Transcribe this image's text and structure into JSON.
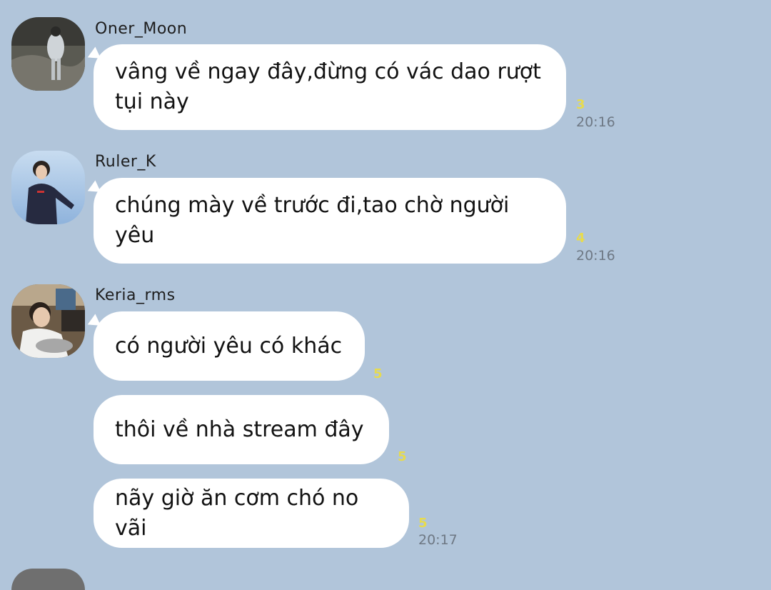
{
  "colors": {
    "background": "#b1c5da",
    "bubble": "#ffffff",
    "read_count": "#e7db4e",
    "timestamp": "#6e7884"
  },
  "messages": [
    {
      "sender": "Oner_Moon",
      "avatar_icon": "avatar-photo-icon",
      "text": "vâng về ngay đây,đừng có vác dao rượt tụi này",
      "read_count": "3",
      "time": "20:16"
    },
    {
      "sender": "Ruler_K",
      "avatar_icon": "avatar-photo-icon",
      "text": "chúng mày về trước đi,tao chờ người yêu",
      "read_count": "4",
      "time": "20:16"
    },
    {
      "sender": "Keria_rms",
      "avatar_icon": "avatar-photo-icon",
      "bubbles": [
        {
          "text": "có người yêu có khác",
          "read_count": "5"
        },
        {
          "text": "thôi về nhà stream đây",
          "read_count": "5"
        },
        {
          "text": "nãy giờ ăn cơm chó no vãi",
          "read_count": "5",
          "time": "20:17"
        }
      ]
    }
  ]
}
